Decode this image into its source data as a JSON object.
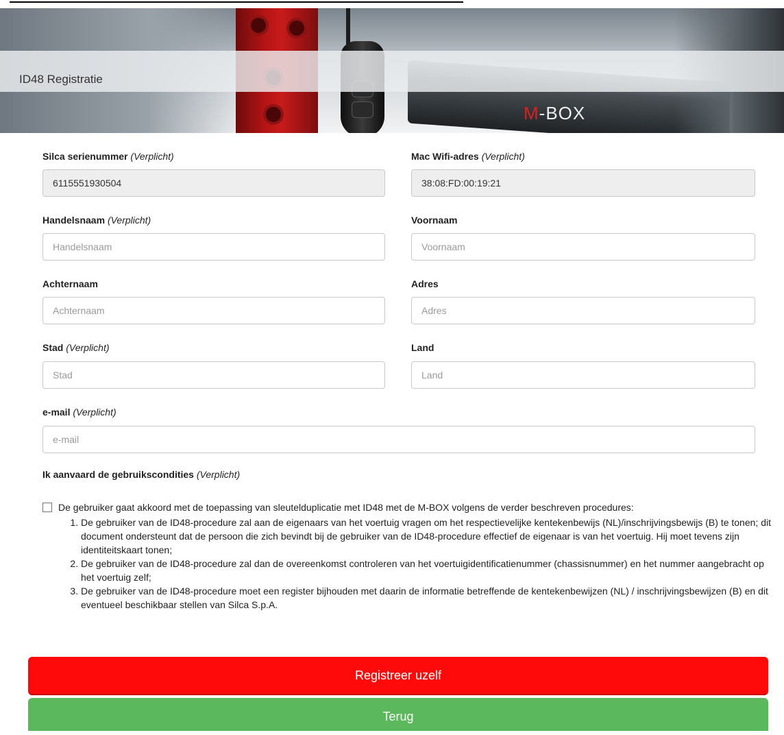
{
  "header": {
    "title": "ID48 Registratie",
    "banner_logo_prefix": "M",
    "banner_logo_suffix": "-BOX"
  },
  "form": {
    "required_suffix": "(Verplicht)",
    "fields": {
      "serial": {
        "label": "Silca serienummer",
        "value": "6115551930504"
      },
      "mac": {
        "label": "Mac Wifi-adres",
        "value": "38:08:FD:00:19:21"
      },
      "trade_name": {
        "label": "Handelsnaam",
        "placeholder": "Handelsnaam"
      },
      "first_name": {
        "label": "Voornaam",
        "placeholder": "Voornaam"
      },
      "last_name": {
        "label": "Achternaam",
        "placeholder": "Achternaam"
      },
      "address": {
        "label": "Adres",
        "placeholder": "Adres"
      },
      "city": {
        "label": "Stad",
        "placeholder": "Stad"
      },
      "country": {
        "label": "Land",
        "placeholder": "Land"
      },
      "email": {
        "label": "e-mail",
        "placeholder": "e-mail"
      }
    }
  },
  "terms": {
    "title": "Ik aanvaard de gebruikscondities",
    "intro": "De gebruiker gaat akkoord met de toepassing van sleutelduplicatie met ID48 met de M-BOX volgens de verder beschreven procedures:",
    "items": [
      "De gebruiker van de ID48-procedure zal aan de eigenaars van het voertuig vragen om het respectievelijke kentekenbewijs (NL)/inschrijvingsbewijs (B) te tonen; dit document ondersteunt dat de persoon die zich bevindt bij de gebruiker van de ID48-procedure effectief de eigenaar is van het voertuig. Hij moet tevens zijn identiteitskaart tonen;",
      "De gebruiker van de ID48-procedure zal dan de overeenkomst controleren van het voertuigidentificatienummer (chassisnummer) en het nummer aangebracht op het voertuig zelf;",
      "De gebruiker van de ID48-procedure moet een register bijhouden met daarin de informatie betreffende de kentekenbewijzen (NL) / inschrijvingsbewijzen (B) en dit eventueel beschikbaar stellen van Silca S.p.A."
    ]
  },
  "buttons": {
    "register": "Registreer uzelf",
    "back": "Terug"
  },
  "colors": {
    "register": "#ff0a0a",
    "back": "#5cb85c"
  }
}
